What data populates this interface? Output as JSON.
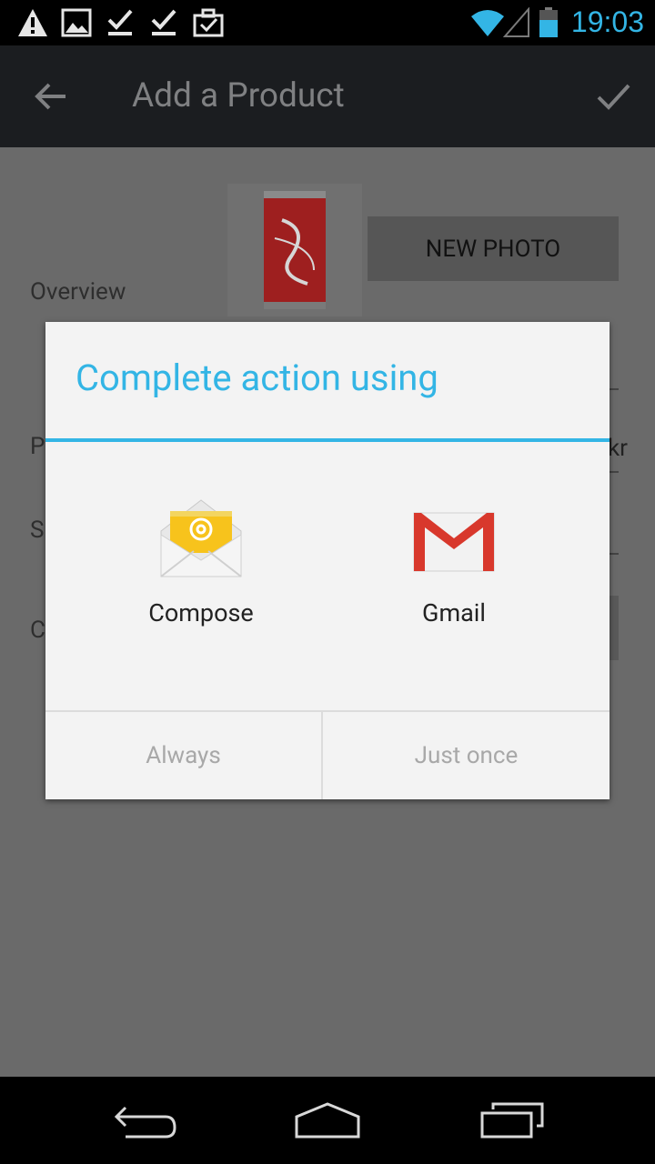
{
  "status_bar": {
    "time": "19:03",
    "icons": [
      "warning-icon",
      "image-icon",
      "download-done-icon",
      "download-done-icon",
      "briefcase-check-icon",
      "wifi-icon",
      "signal-icon",
      "battery-icon"
    ]
  },
  "action_bar": {
    "title": "Add a Product",
    "back_icon": "back-arrow-icon",
    "confirm_icon": "checkmark-icon"
  },
  "form": {
    "new_photo_label": "NEW PHOTO",
    "overview_label": "Overview",
    "row_labels": [
      "P",
      "S",
      "C"
    ],
    "partial_value": "kr"
  },
  "dialog": {
    "title": "Complete action using",
    "options": [
      {
        "label": "Compose",
        "icon": "email-compose-icon"
      },
      {
        "label": "Gmail",
        "icon": "gmail-icon"
      }
    ],
    "always_label": "Always",
    "just_once_label": "Just once"
  },
  "colors": {
    "accent": "#33b5e5",
    "scrim": "#6a6a6a",
    "dialog_bg": "#f3f3f3",
    "gmail_red": "#d8382c",
    "email_yellow": "#f7c31c"
  },
  "nav_bar": {
    "icons": [
      "nav-back-icon",
      "nav-home-icon",
      "nav-recents-icon"
    ]
  }
}
